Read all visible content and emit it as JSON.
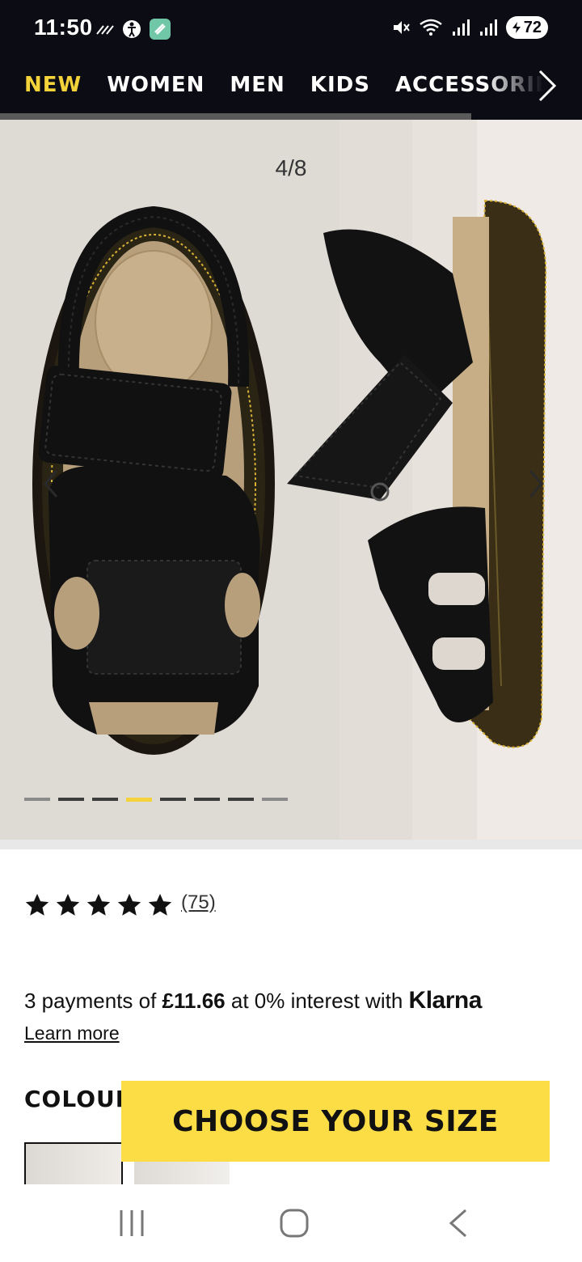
{
  "status_bar": {
    "time": "11:50",
    "battery": "72",
    "icons": [
      "signal-dots-icon",
      "accessibility-icon",
      "app-icon",
      "mute-icon",
      "wifi-icon",
      "signal-icon",
      "signal-icon"
    ]
  },
  "nav": {
    "items": [
      {
        "label": "NEW",
        "active": true
      },
      {
        "label": "WOMEN",
        "active": false
      },
      {
        "label": "MEN",
        "active": false
      },
      {
        "label": "KIDS",
        "active": false
      },
      {
        "label": "ACCESSORIES",
        "active": false
      }
    ],
    "more_icon": "chevron-right-icon",
    "accent": "#f4d33a",
    "scroll_progress": 0.81
  },
  "gallery": {
    "counter": "4/8",
    "current": 4,
    "total": 8
  },
  "reviews": {
    "stars": 5,
    "count": "(75)"
  },
  "klarna": {
    "prefix": "3 payments of ",
    "amount": "£11.66",
    "suffix": " at 0% interest with ",
    "brand": "Klarna",
    "learn_more": "Learn more"
  },
  "colour": {
    "label": "COLOUR"
  },
  "cta": {
    "label": "CHOOSE YOUR SIZE",
    "color": "#fcdd45"
  },
  "system_nav": {
    "icons": [
      "recent-apps-icon",
      "home-icon",
      "back-icon"
    ]
  }
}
